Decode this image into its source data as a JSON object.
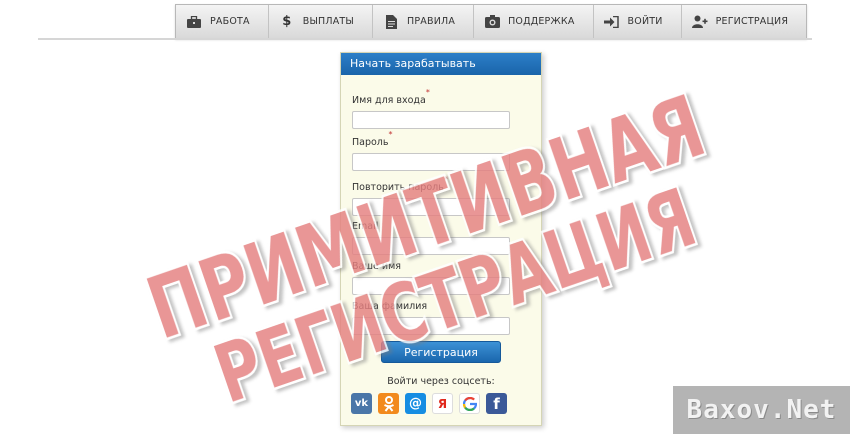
{
  "nav": {
    "items": [
      {
        "label": "РАБОТА",
        "icon": "briefcase-icon"
      },
      {
        "label": "ВЫПЛАТЫ",
        "icon": "dollar-icon"
      },
      {
        "label": "ПРАВИЛА",
        "icon": "document-icon"
      },
      {
        "label": "ПОДДЕРЖКА",
        "icon": "support-icon"
      },
      {
        "label": "ВОЙТИ",
        "icon": "login-icon"
      },
      {
        "label": "РЕГИСТРАЦИЯ",
        "icon": "add-user-icon"
      }
    ]
  },
  "form": {
    "title": "Начать зарабатывать",
    "fields": [
      {
        "label": "Имя для входа",
        "required": "*",
        "value": ""
      },
      {
        "label": "Пароль",
        "required": "*",
        "value": ""
      },
      {
        "label": "Повторить пароль",
        "required": "*",
        "value": ""
      },
      {
        "label": "Email",
        "required": "",
        "value": ""
      },
      {
        "label": "Ваше имя",
        "required": "",
        "value": ""
      },
      {
        "label": "Ваша фамилия",
        "required": "",
        "value": ""
      }
    ],
    "submit_label": "Регистрация",
    "social_title": "Войти через соцсеть:",
    "social": [
      {
        "icon": "vk-icon",
        "glyph": "vk",
        "color": "#4a76a8"
      },
      {
        "icon": "odnoklassniki-icon",
        "glyph": "ok",
        "color": "#f28a1d"
      },
      {
        "icon": "mailru-icon",
        "glyph": "@",
        "color": "#168de2"
      },
      {
        "icon": "yandex-icon",
        "glyph": "Я",
        "color": "#ffffff"
      },
      {
        "icon": "google-icon",
        "glyph": "G",
        "color": "#ffffff"
      },
      {
        "icon": "facebook-icon",
        "glyph": "f",
        "color": "#3b5998"
      }
    ]
  },
  "stamp": {
    "line1": "ПРИМИТИВНАЯ",
    "line2": "РЕГИСТРАЦИЯ",
    "color": "#e77b7b"
  },
  "logo": {
    "text": "Baxov.Net"
  }
}
